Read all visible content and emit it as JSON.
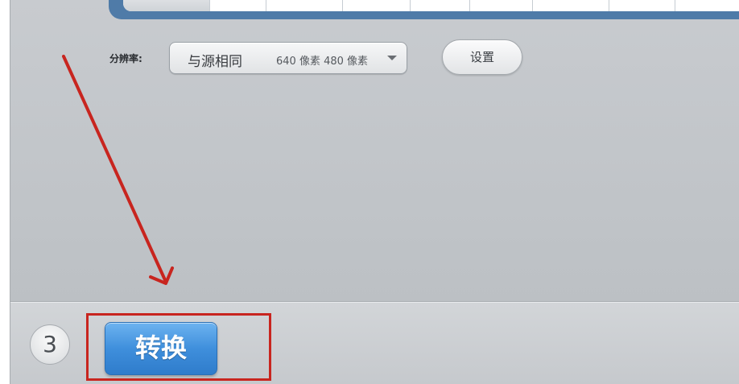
{
  "resolution": {
    "label": "分辨率:",
    "selected_main": "与源相同",
    "selected_detail": "640 像素 480 像素",
    "caret_icon": "chevron-down-icon"
  },
  "settings_button": {
    "label": "设置"
  },
  "step": {
    "number": "3"
  },
  "convert_button": {
    "label": "转换"
  },
  "annotation": {
    "color": "#c8251f"
  },
  "colors": {
    "convert_blue": "#3f8fdc",
    "table_frame_blue": "#4f7ba8"
  }
}
